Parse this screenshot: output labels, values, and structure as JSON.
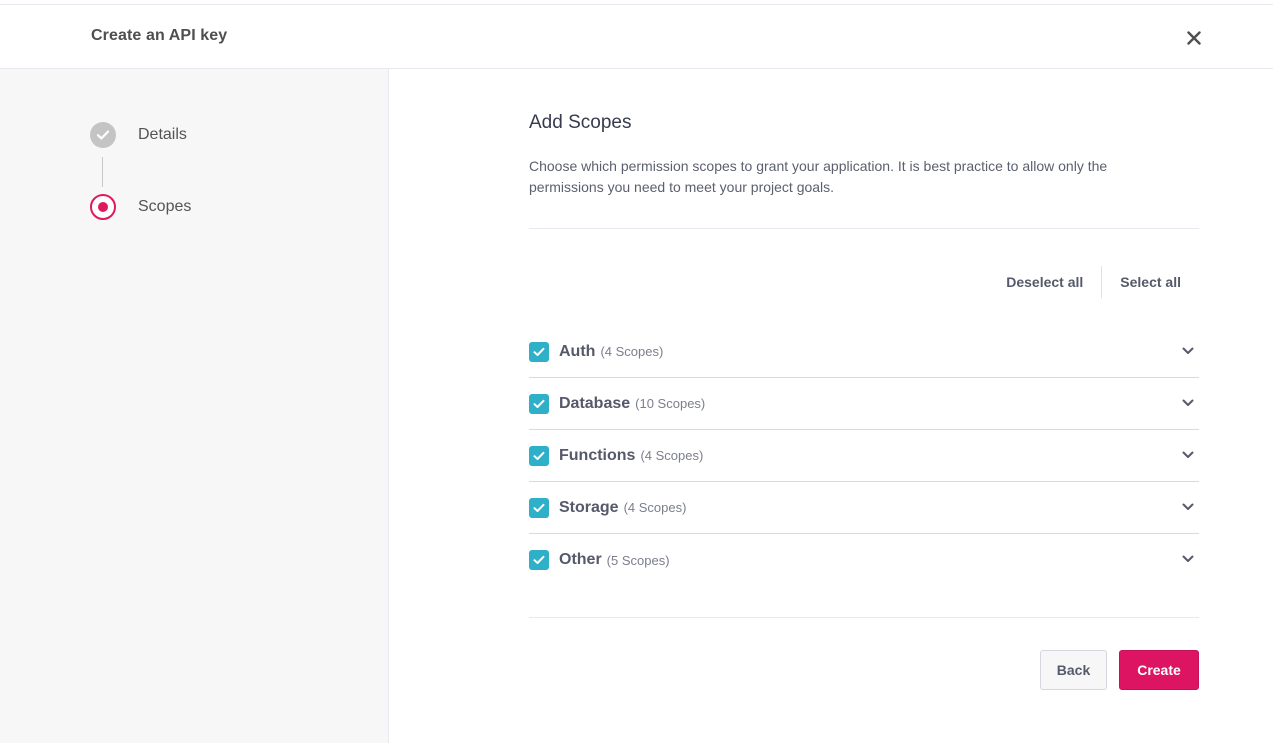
{
  "header": {
    "title": "Create an API key",
    "close_icon": "close-icon"
  },
  "steps": [
    {
      "label": "Details",
      "state": "completed",
      "icon": "check-icon"
    },
    {
      "label": "Scopes",
      "state": "active",
      "icon": "active-dot-icon"
    }
  ],
  "main": {
    "title": "Add Scopes",
    "description": "Choose which permission scopes to grant your application. It is best practice to allow only the permissions you need to meet your project goals.",
    "deselect_all": "Deselect all",
    "select_all": "Select all",
    "scopes": [
      {
        "name": "Auth",
        "count": "(4 Scopes)",
        "checked": true
      },
      {
        "name": "Database",
        "count": "(10 Scopes)",
        "checked": true
      },
      {
        "name": "Functions",
        "count": "(4 Scopes)",
        "checked": true
      },
      {
        "name": "Storage",
        "count": "(4 Scopes)",
        "checked": true
      },
      {
        "name": "Other",
        "count": "(5 Scopes)",
        "checked": true
      }
    ],
    "back_label": "Back",
    "create_label": "Create"
  },
  "colors": {
    "accent": "#dd1462",
    "checkbox": "#2eb0c9",
    "step_done": "#c4c4c4",
    "sidebar_bg": "#f7f7f7"
  }
}
